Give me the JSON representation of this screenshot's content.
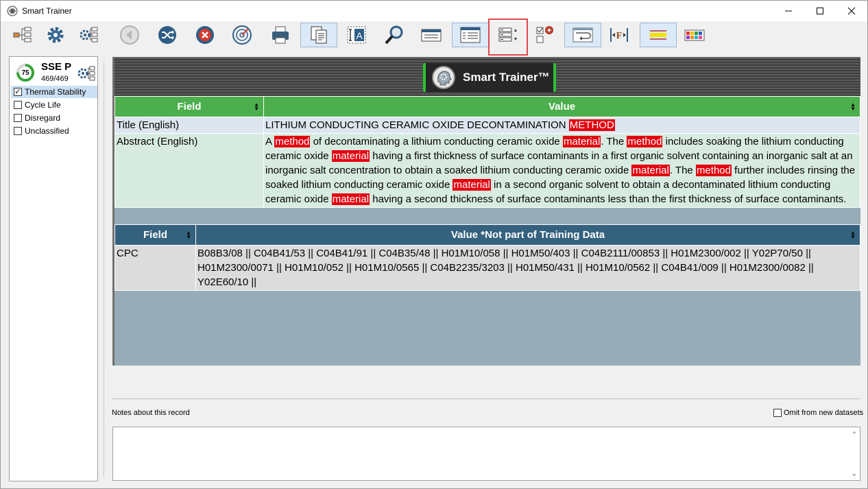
{
  "window": {
    "title": "Smart Trainer"
  },
  "toolbar": {
    "buttons": [
      "dataset-tree-icon",
      "settings-gear-icon",
      "dataset-settings-icon",
      "back-icon",
      "shuffle-icon",
      "cancel-icon",
      "radar-icon",
      "print-icon",
      "copy-record-icon",
      "text-field-icon",
      "search-icon",
      "single-view-icon",
      "list-view-icon",
      "field-order-icon",
      "add-checkbox-icon",
      "wrap-text-icon",
      "field-width-icon",
      "highlight-icon",
      "color-palette-icon"
    ]
  },
  "sidebar": {
    "dataset_name": "SSE P",
    "dataset_count": "469/469",
    "score": "75",
    "categories": [
      {
        "label": "Thermal Stability",
        "checked": true,
        "selected": true
      },
      {
        "label": "Cycle Life",
        "checked": false,
        "selected": false
      },
      {
        "label": "Disregard",
        "checked": false,
        "selected": false
      },
      {
        "label": "Unclassified",
        "checked": false,
        "selected": false
      }
    ]
  },
  "banner": {
    "logo_text": "Smart Trainer™"
  },
  "training_table": {
    "headers": [
      "Field",
      "Value"
    ],
    "title_field": "Title (English)",
    "title_text": "LITHIUM CONDUCTING CERAMIC OXIDE DECONTAMINATION",
    "title_highlight": "METHOD",
    "abstract_field": "Abstract (English)",
    "abstract_parts": [
      {
        "t": "A ",
        "h": false
      },
      {
        "t": "method",
        "h": true
      },
      {
        "t": " of decontaminating a lithium conducting ceramic oxide ",
        "h": false
      },
      {
        "t": "material",
        "h": true
      },
      {
        "t": ". The ",
        "h": false
      },
      {
        "t": "method",
        "h": true
      },
      {
        "t": " includes soaking the lithium conducting ceramic oxide ",
        "h": false
      },
      {
        "t": "material",
        "h": true
      },
      {
        "t": " having a first thickness of surface contaminants in a first organic solvent containing an inorganic salt at an inorganic salt concentration to obtain a soaked lithium conducting ceramic oxide ",
        "h": false
      },
      {
        "t": "material",
        "h": true
      },
      {
        "t": ". The ",
        "h": false
      },
      {
        "t": "method",
        "h": true
      },
      {
        "t": " further includes rinsing the soaked lithium conducting ceramic oxide ",
        "h": false
      },
      {
        "t": "material",
        "h": true
      },
      {
        "t": " in a second organic solvent to obtain a decontaminated lithium conducting ceramic oxide ",
        "h": false
      },
      {
        "t": "material",
        "h": true
      },
      {
        "t": " having a second thickness of surface contaminants less than the first thickness of surface contaminants.",
        "h": false
      }
    ]
  },
  "extra_table": {
    "headers": [
      "Field",
      "Value *Not part of Training Data"
    ],
    "field": "CPC",
    "value": "B08B3/08 || C04B41/53 || C04B41/91 || C04B35/48 || H01M10/058 || H01M50/403 || C04B2111/00853 || H01M2300/002 || Y02P70/50 || H01M2300/0071 || H01M10/052 || H01M10/0565 || C04B2235/3203 || H01M50/431 || H01M10/0562 || C04B41/009 || H01M2300/0082 || Y02E60/10 ||"
  },
  "notes": {
    "label": "Notes about this record",
    "omit_label": "Omit from new datasets",
    "value": ""
  },
  "colors": {
    "training_header": "#4cae4c",
    "extra_header": "#34617e",
    "highlight": "#e3000f",
    "logo_border": "#2ec331"
  }
}
